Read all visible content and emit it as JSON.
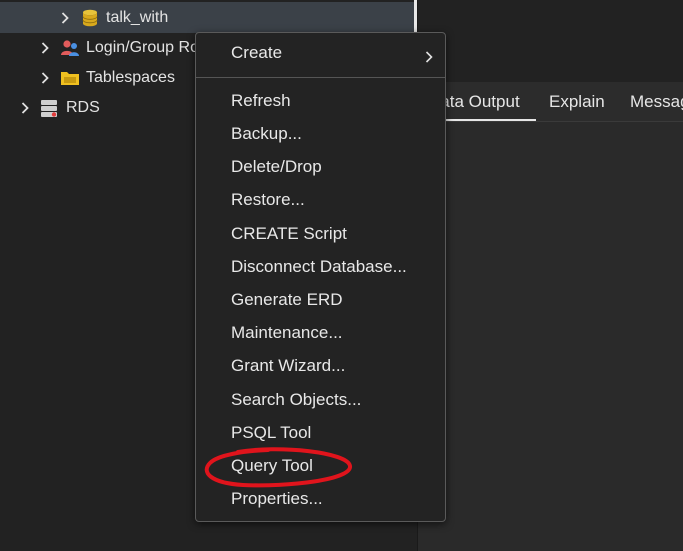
{
  "tree": {
    "items": [
      {
        "label": "talk_with",
        "icon": "database-icon"
      },
      {
        "label": "Login/Group Roles",
        "icon": "users-icon"
      },
      {
        "label": "Tablespaces",
        "icon": "folder-icon"
      },
      {
        "label": "RDS",
        "icon": "server-icon"
      }
    ]
  },
  "tabs": [
    {
      "label": "Data Output"
    },
    {
      "label": "Explain"
    },
    {
      "label": "Messages"
    }
  ],
  "menu": {
    "create": "Create",
    "items": [
      "Refresh",
      "Backup...",
      "Delete/Drop",
      "Restore...",
      "CREATE Script",
      "Disconnect Database...",
      "Generate ERD",
      "Maintenance...",
      "Grant Wizard...",
      "Search Objects...",
      "PSQL Tool",
      "Query Tool",
      "Properties..."
    ]
  },
  "colors": {
    "background": "#222222",
    "menu_background": "#232323",
    "selected_row": "#3b4148",
    "annotation_red": "#e0141c",
    "database_icon": "#e8c33a",
    "folder_icon": "#f0c020"
  }
}
